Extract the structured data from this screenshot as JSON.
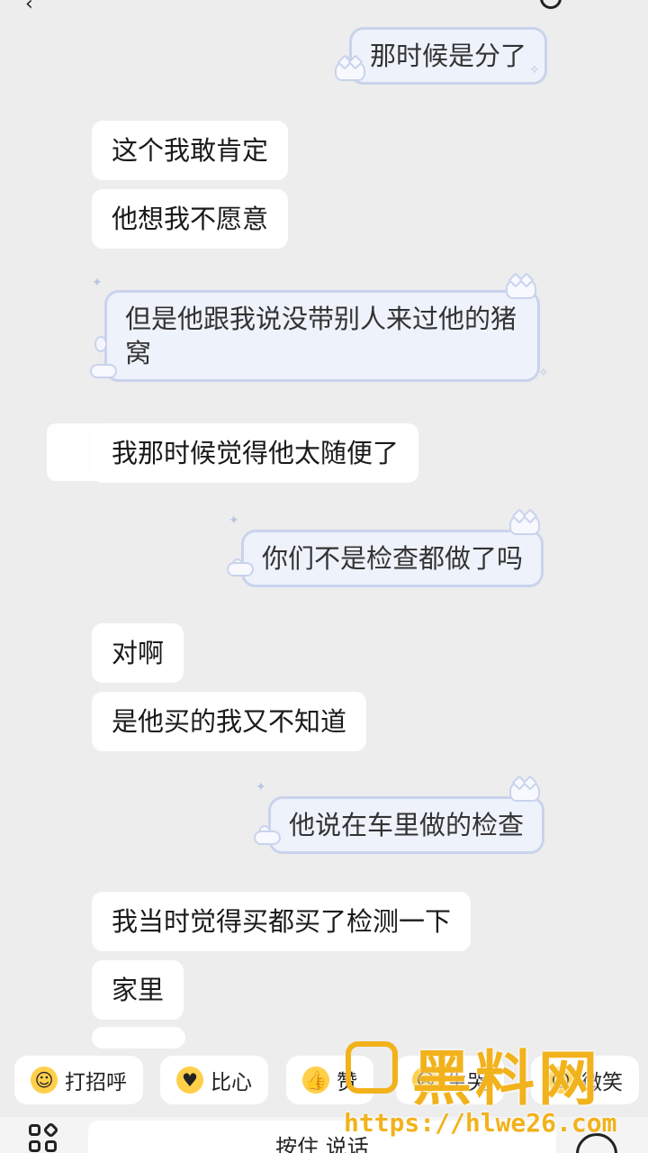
{
  "messages": [
    {
      "side": "right",
      "text": "那时候是分了"
    },
    {
      "side": "left",
      "text": "这个我敢肯定"
    },
    {
      "side": "left",
      "text": "他想我不愿意"
    },
    {
      "side": "right",
      "text": "但是他跟我说没带别人来过他的猪窝"
    },
    {
      "side": "left",
      "text": "我那时候觉得他太随便了"
    },
    {
      "side": "right",
      "text": "你们不是检查都做了吗"
    },
    {
      "side": "left",
      "text": "对啊"
    },
    {
      "side": "left",
      "text": "是他买的我又不知道"
    },
    {
      "side": "right",
      "text": "他说在车里做的检查"
    },
    {
      "side": "left",
      "text": "我当时觉得买都买了检测一下"
    },
    {
      "side": "left",
      "text": "家里"
    }
  ],
  "quick_replies": [
    {
      "label": "打招呼",
      "icon": "smile-emoji-icon"
    },
    {
      "label": "比心",
      "icon": "heart-hands-emoji-icon"
    },
    {
      "label": "赞",
      "icon": "thumbs-up-icon"
    },
    {
      "label": "生哭",
      "icon": "cry-emoji-icon"
    },
    {
      "label": "微笑",
      "icon": "smile-emoji-icon"
    }
  ],
  "input": {
    "placeholder": "按住 说话"
  },
  "watermark": {
    "brand": "黑料网",
    "url": "https://hlwe26.com"
  },
  "colors": {
    "background": "#ededed",
    "bubble_left": "#ffffff",
    "bubble_right": "#eef2fb",
    "bubble_right_border": "#c9d3ec",
    "watermark": "#f2b21b"
  }
}
